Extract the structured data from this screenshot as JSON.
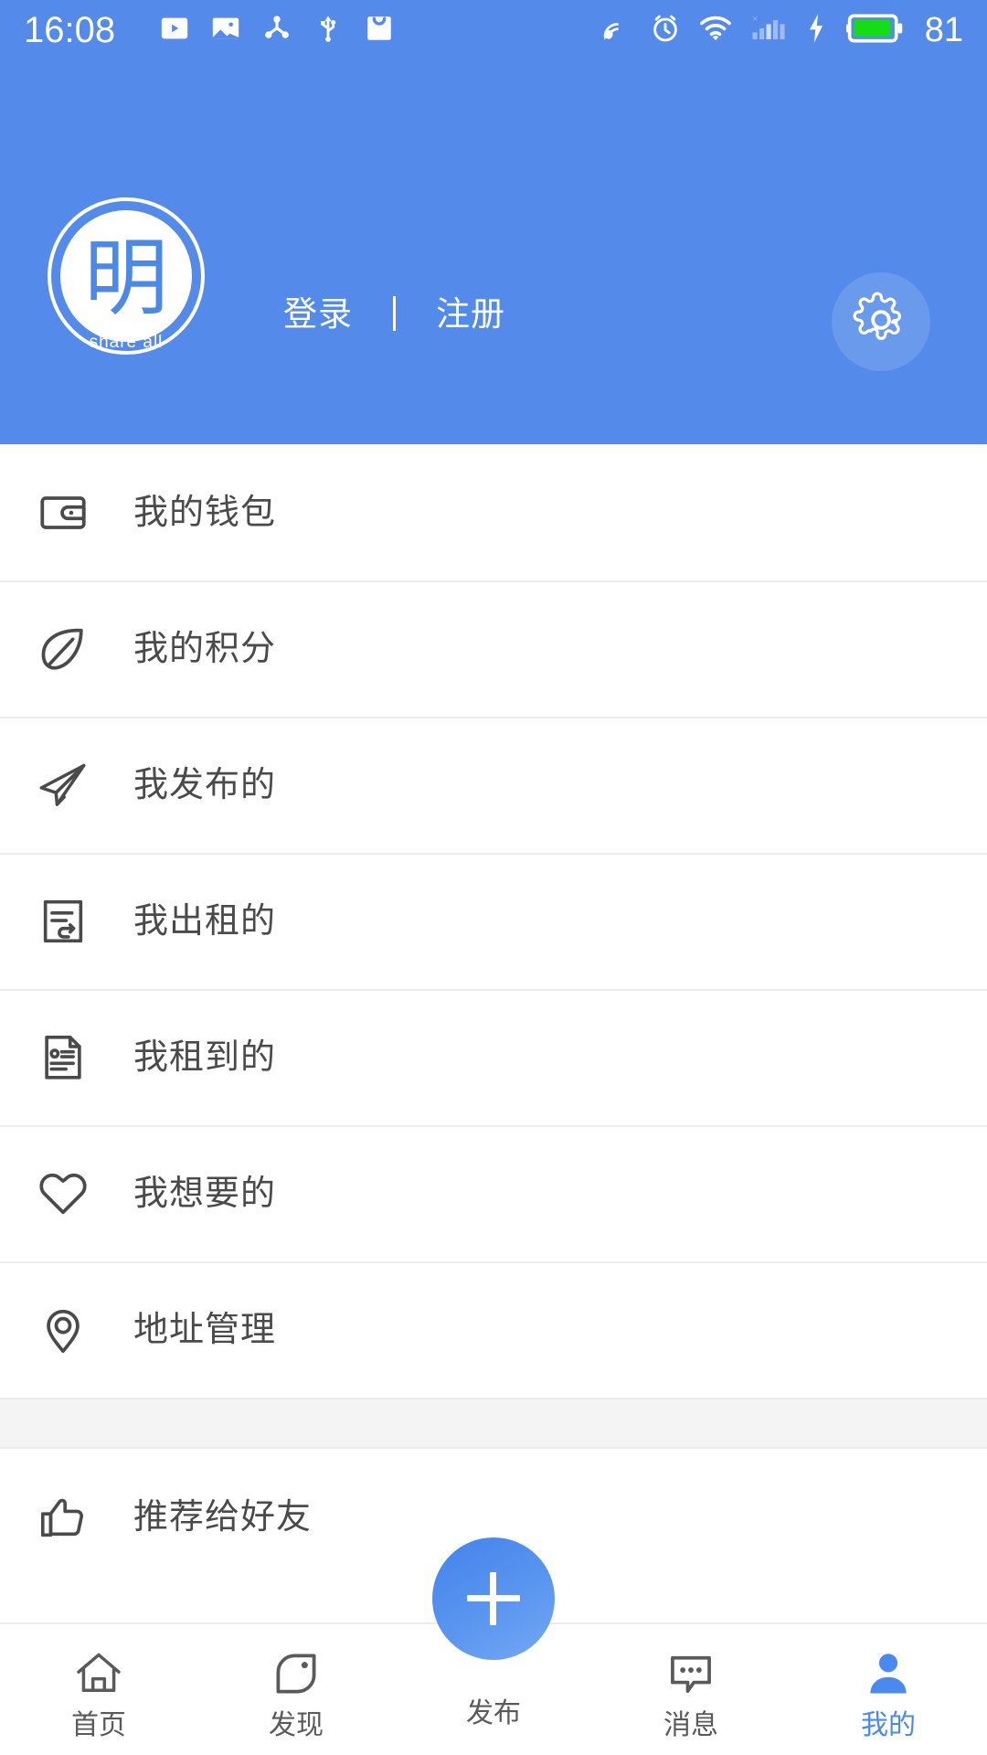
{
  "status_bar": {
    "time": "16:08",
    "battery_percent": "81",
    "left_icons": [
      "video-play-icon",
      "image-icon",
      "share-nodes-icon",
      "usb-icon",
      "inbox-icon"
    ],
    "right_icons": [
      "location-satellite-icon",
      "alarm-clock-icon",
      "wifi-icon",
      "cellular-signal-icon",
      "charging-bolt-icon",
      "battery-icon"
    ],
    "bg_color": "#548bea"
  },
  "header": {
    "bg_color": "#548bea",
    "avatar": {
      "character": "明",
      "subtitle": "share all"
    },
    "login_label": "登录",
    "register_label": "注册",
    "settings_icon": "gear-icon"
  },
  "menu": {
    "group_one": [
      {
        "icon": "wallet-icon",
        "label": "我的钱包"
      },
      {
        "icon": "leaf-icon",
        "label": "我的积分"
      },
      {
        "icon": "paper-plane-icon",
        "label": "我发布的"
      },
      {
        "icon": "rent-out-doc-icon",
        "label": "我出租的"
      },
      {
        "icon": "rented-doc-icon",
        "label": "我租到的"
      },
      {
        "icon": "heart-icon",
        "label": "我想要的"
      },
      {
        "icon": "location-pin-icon",
        "label": "地址管理"
      }
    ],
    "group_two": [
      {
        "icon": "thumbs-up-icon",
        "label": "推荐给好友"
      }
    ]
  },
  "bottom_nav": {
    "active_color": "#4a89f0",
    "items": [
      {
        "icon": "home-icon",
        "label": "首页",
        "active": false
      },
      {
        "icon": "discover-icon",
        "label": "发现",
        "active": false
      },
      {
        "icon": "plus-icon",
        "label": "发布",
        "active": false
      },
      {
        "icon": "message-icon",
        "label": "消息",
        "active": false
      },
      {
        "icon": "person-icon",
        "label": "我的",
        "active": true
      }
    ]
  }
}
